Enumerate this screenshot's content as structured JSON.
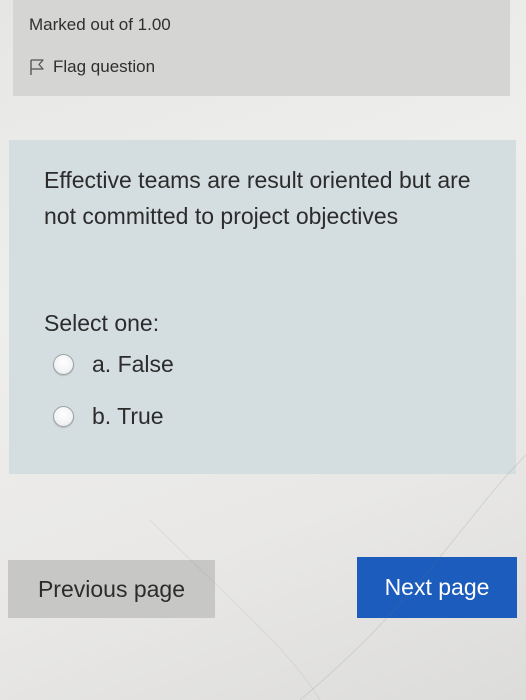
{
  "info": {
    "marked": "Marked out of 1.00",
    "flag_label": "Flag question"
  },
  "question": {
    "text": "Effective teams are result oriented but are not committed to project objectives",
    "prompt": "Select one:",
    "answers": [
      {
        "label": "a. False",
        "selected": false
      },
      {
        "label": "b. True",
        "selected": false
      }
    ]
  },
  "navigation": {
    "previous_label": "Previous page",
    "next_label": "Next page"
  },
  "colors": {
    "info_bg": "#d5d5d3",
    "question_bg": "#d4dde0",
    "next_button": "#1b5cbd",
    "previous_button": "#c7c7c5"
  },
  "icons": {
    "flag": "flag-icon",
    "radio": "radio-button"
  }
}
